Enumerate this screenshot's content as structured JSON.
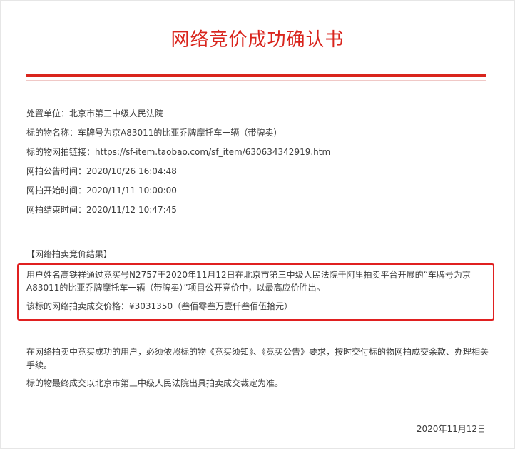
{
  "document": {
    "title": "网络竞价成功确认书",
    "info": [
      {
        "label": "处置单位：",
        "value": "北京市第三中级人民法院"
      },
      {
        "label": "标的物名称：",
        "value": "车牌号为京A83011的比亚乔牌摩托车一辆（带牌卖）"
      },
      {
        "label": "标的物网拍链接：",
        "value": "https://sf-item.taobao.com/sf_item/630634342919.htm"
      },
      {
        "label": "网拍公告时间：",
        "value": "2020/10/26 16:04:48"
      },
      {
        "label": "网拍开始时间：",
        "value": "2020/11/11 10:00:00"
      },
      {
        "label": "网拍结束时间：",
        "value": "2020/11/12 10:47:45"
      }
    ],
    "result_heading": "【网络拍卖竞价结果】",
    "result_line1": "用户姓名高铁祥通过竞买号N2757于2020年11月12日在北京市第三中级人民法院于阿里拍卖平台开展的“车牌号为京A83011的比亚乔牌摩托车一辆（带牌卖）”项目公开竞价中，以最高应价胜出。",
    "result_line2": "该标的网络拍卖成交价格：¥3031350（叁佰零叁万壹仟叁佰伍拾元）",
    "paragraph1": "在网络拍卖中竞买成功的用户，必须依照标的物《竞买须知》、《竞买公告》要求，按时交付标的物网拍成交余款、办理相关手续。",
    "paragraph2": "标的物最终成交以北京市第三中级人民法院出具拍卖成交裁定为准。",
    "date": "2020年11月12日"
  },
  "colors": {
    "accent": "#d9251d",
    "highlight_border": "#e02020",
    "text": "#3c3c3c"
  }
}
